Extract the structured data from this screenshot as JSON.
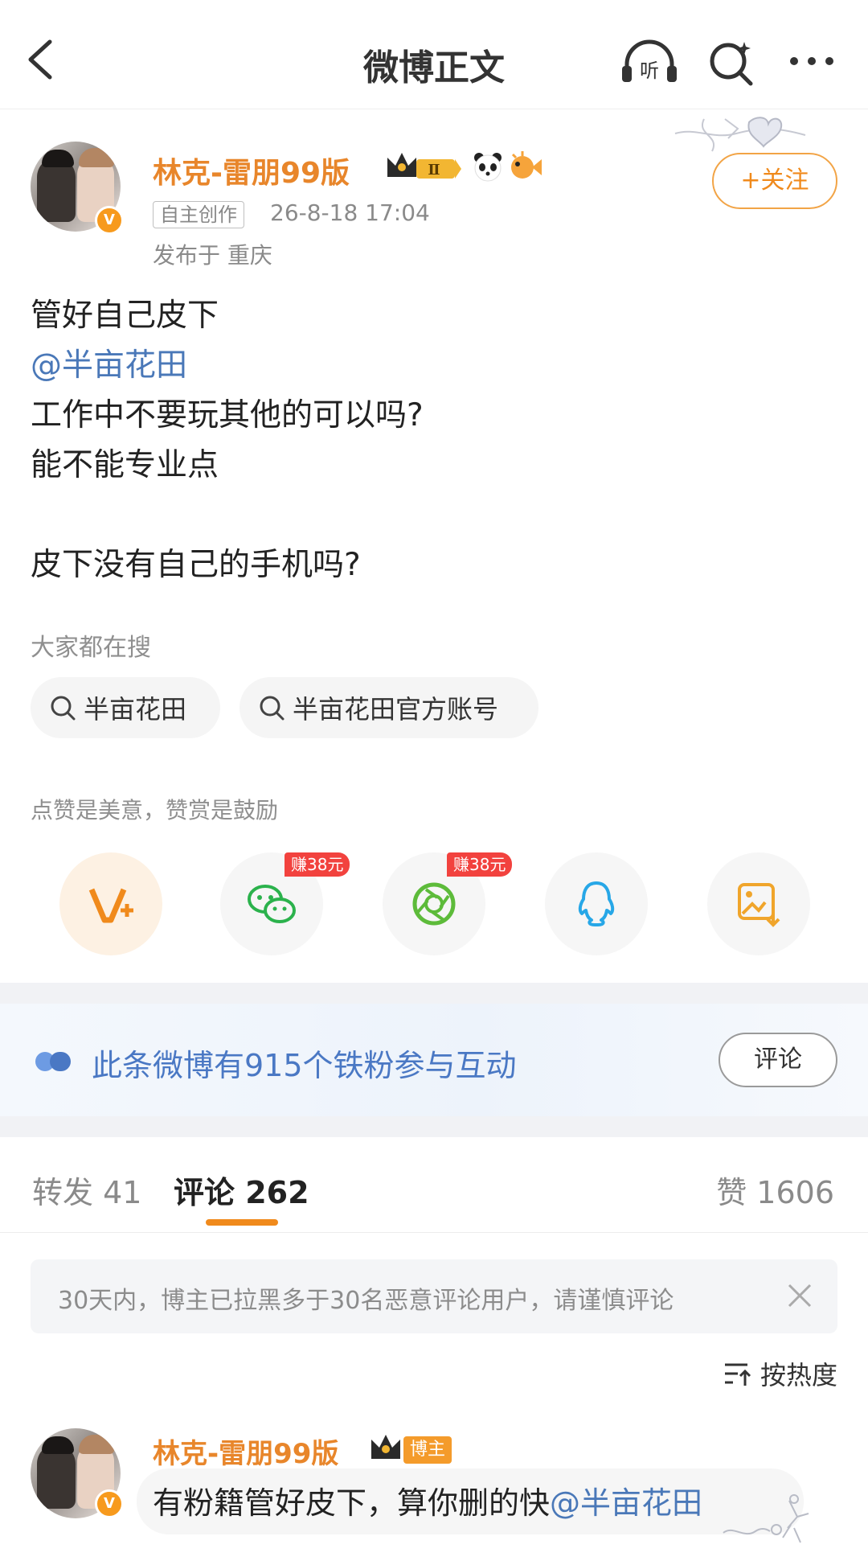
{
  "nav": {
    "title": "微博正文",
    "listen_label": "听"
  },
  "post": {
    "username": "林克-雷朋99版",
    "level_badge": "Ⅱ",
    "verified_mark": "V",
    "tag_self": "自主创作",
    "time": "26-8-18 17:04",
    "location": "发布于 重庆",
    "follow_label": "+关注",
    "lines": [
      "管好自己皮下",
      "@半亩花田",
      "工作中不要玩其他的可以吗?",
      "能不能专业点",
      "",
      "皮下没有自己的手机吗?"
    ]
  },
  "searches": {
    "hint": "大家都在搜",
    "items": [
      "半亩花田",
      "半亩花田官方账号"
    ]
  },
  "reward": {
    "hint": "点赞是美意，赞赏是鼓励",
    "earn_badges": [
      "赚38元",
      "赚38元"
    ]
  },
  "fans": {
    "text": "此条微博有915个铁粉参与互动",
    "button": "评论"
  },
  "tabs": {
    "repost": "转发 41",
    "comment": "评论 262",
    "like": "赞 1606"
  },
  "notice": {
    "text": "30天内，博主已拉黑多于30名恶意评论用户，请谨慎评论"
  },
  "sort": {
    "label": "按热度"
  },
  "comment": {
    "username": "林克-雷朋99版",
    "blogger_tag": "博主",
    "text_prefix": "有粉籍管好皮下，算你删的快",
    "mention": "@半亩花田"
  },
  "colors": {
    "accent_orange": "#f08a1c",
    "link_blue": "#4a78b8",
    "earn_red": "#f2423e"
  },
  "icons": [
    "back-icon",
    "listen-icon",
    "search-icon",
    "more-icon",
    "crown-icon",
    "panda-icon",
    "pufferfish-icon",
    "search-small-icon",
    "reward-v-icon",
    "wechat-icon",
    "moments-icon",
    "qq-icon",
    "save-image-icon",
    "fans-icon",
    "close-icon",
    "sort-icon"
  ]
}
